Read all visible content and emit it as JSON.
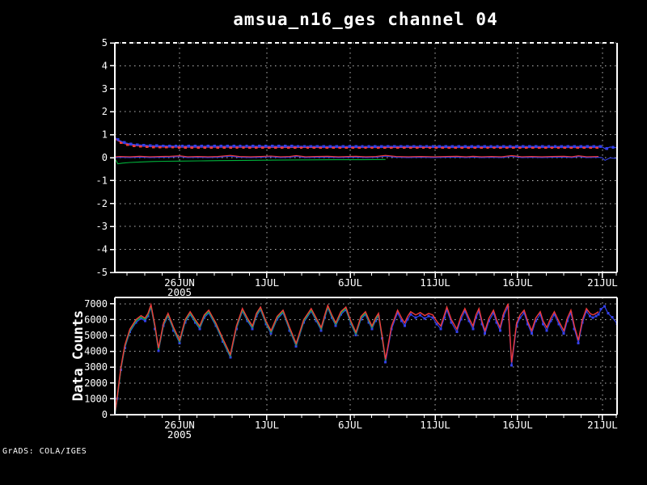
{
  "title": "amsua_n16_ges channel 04",
  "page": {
    "credit": "GrADS: COLA/IGES",
    "background": "#000000"
  },
  "colors": {
    "red": "#f03a3a",
    "green": "#00b43c",
    "blue": "#3340e8",
    "axis": "#ffffff",
    "grid": "#b8b8b8",
    "text": "#ffffff"
  },
  "x_axis": {
    "labels": [
      "26JUN",
      "1JUL",
      "6JUL",
      "11JUL",
      "16JUL",
      "21JUL"
    ],
    "year_label": "2005",
    "year_under_index": 0,
    "label_positions": [
      0.1288,
      0.3027,
      0.4686,
      0.6377,
      0.8019,
      0.971
    ],
    "minor_tick_step": 0.03478
  },
  "chart_data": [
    {
      "type": "line",
      "title": "amsua_n16_ges channel 04",
      "ylim": [
        -5,
        5
      ],
      "yticks": [
        5,
        4,
        3,
        2,
        1,
        0,
        -1,
        -2,
        -3,
        -4,
        -5
      ],
      "grid": "dotted",
      "series": [
        {
          "name": "top-green-line",
          "color": "green",
          "style": "line",
          "points": [
            [
              0.0,
              -0.04
            ],
            [
              0.006,
              -0.27
            ],
            [
              0.015,
              -0.24
            ],
            [
              0.03,
              -0.21
            ],
            [
              0.05,
              -0.19
            ],
            [
              0.075,
              -0.17
            ],
            [
              0.1,
              -0.16
            ],
            [
              0.13,
              -0.15
            ],
            [
              0.17,
              -0.14
            ],
            [
              0.21,
              -0.13
            ],
            [
              0.26,
              -0.12
            ],
            [
              0.32,
              -0.11
            ],
            [
              0.38,
              -0.1
            ],
            [
              0.44,
              -0.09
            ],
            [
              0.49,
              -0.09
            ],
            [
              0.539,
              -0.08
            ]
          ]
        },
        {
          "name": "top-blue-line",
          "color": "blue",
          "style": "line",
          "from": "top-red-line",
          "value_offset": -0.035,
          "extra": [
            [
              0.97,
              0.0
            ],
            [
              0.976,
              -0.12
            ],
            [
              0.986,
              -0.01
            ],
            [
              1.0,
              -0.04
            ]
          ]
        },
        {
          "name": "top-red-line",
          "color": "red",
          "style": "line",
          "points": [
            [
              0.0,
              0.03
            ],
            [
              0.01,
              0.05
            ],
            [
              0.03,
              0.04
            ],
            [
              0.05,
              0.06
            ],
            [
              0.07,
              0.04
            ],
            [
              0.09,
              0.05
            ],
            [
              0.11,
              0.06
            ],
            [
              0.129,
              0.08
            ],
            [
              0.145,
              0.04
            ],
            [
              0.165,
              0.05
            ],
            [
              0.185,
              0.04
            ],
            [
              0.205,
              0.05
            ],
            [
              0.23,
              0.1
            ],
            [
              0.248,
              0.05
            ],
            [
              0.27,
              0.04
            ],
            [
              0.29,
              0.05
            ],
            [
              0.311,
              0.07
            ],
            [
              0.33,
              0.04
            ],
            [
              0.348,
              0.05
            ],
            [
              0.361,
              0.09
            ],
            [
              0.38,
              0.04
            ],
            [
              0.4,
              0.05
            ],
            [
              0.424,
              0.06
            ],
            [
              0.445,
              0.04
            ],
            [
              0.465,
              0.05
            ],
            [
              0.48,
              0.06
            ],
            [
              0.5,
              0.04
            ],
            [
              0.52,
              0.05
            ],
            [
              0.539,
              0.1
            ],
            [
              0.56,
              0.05
            ],
            [
              0.585,
              0.04
            ],
            [
              0.61,
              0.05
            ],
            [
              0.635,
              0.04
            ],
            [
              0.66,
              0.05
            ],
            [
              0.681,
              0.06
            ],
            [
              0.7,
              0.04
            ],
            [
              0.713,
              0.06
            ],
            [
              0.73,
              0.04
            ],
            [
              0.75,
              0.05
            ],
            [
              0.77,
              0.04
            ],
            [
              0.79,
              0.09
            ],
            [
              0.81,
              0.04
            ],
            [
              0.83,
              0.05
            ],
            [
              0.85,
              0.04
            ],
            [
              0.87,
              0.05
            ],
            [
              0.894,
              0.06
            ],
            [
              0.91,
              0.04
            ],
            [
              0.923,
              0.08
            ],
            [
              0.94,
              0.04
            ],
            [
              0.963,
              0.05
            ]
          ]
        },
        {
          "name": "top-red-band",
          "color": "red",
          "style": "band",
          "marker_step": 0.0128,
          "marker_phase": 0,
          "points": [
            [
              0.0,
              0.82
            ],
            [
              0.004,
              0.76
            ],
            [
              0.009,
              0.7
            ],
            [
              0.015,
              0.64
            ],
            [
              0.022,
              0.59
            ],
            [
              0.03,
              0.55
            ],
            [
              0.04,
              0.52
            ],
            [
              0.052,
              0.5
            ],
            [
              0.065,
              0.48
            ],
            [
              0.08,
              0.47
            ],
            [
              0.1,
              0.46
            ],
            [
              0.13,
              0.455
            ],
            [
              0.17,
              0.45
            ],
            [
              0.22,
              0.45
            ],
            [
              0.28,
              0.448
            ],
            [
              0.35,
              0.445
            ],
            [
              0.42,
              0.44
            ],
            [
              0.5,
              0.44
            ],
            [
              0.58,
              0.443
            ],
            [
              0.66,
              0.44
            ],
            [
              0.74,
              0.44
            ],
            [
              0.82,
              0.44
            ],
            [
              0.9,
              0.44
            ],
            [
              0.963,
              0.44
            ]
          ]
        },
        {
          "name": "top-blue-band",
          "color": "blue",
          "style": "band",
          "marker_step": 0.0128,
          "marker_phase": 0.5,
          "from": "top-red-band",
          "value_offset": 0.05,
          "extra": [
            [
              0.97,
              0.47
            ],
            [
              0.977,
              0.38
            ],
            [
              0.986,
              0.46
            ],
            [
              1.0,
              0.43
            ]
          ]
        }
      ]
    },
    {
      "type": "line",
      "ylabel": "Data Counts",
      "ylim": [
        0,
        7400
      ],
      "yticks": [
        7000,
        6000,
        5000,
        4000,
        3000,
        2000,
        1000,
        0
      ],
      "grid": "dotted",
      "series": [
        {
          "name": "bottom-blue",
          "color": "blue",
          "style": "line-markers",
          "from": "bottom-red",
          "value_offset": -180,
          "extra": [
            [
              0.968,
              6650
            ],
            [
              0.975,
              6850
            ],
            [
              0.982,
              6400
            ],
            [
              0.99,
              6150
            ],
            [
              1.0,
              5750
            ]
          ]
        },
        {
          "name": "bottom-green",
          "color": "green",
          "style": "line",
          "from": "bottom-red",
          "value_offset": -90,
          "u_max": 0.539
        },
        {
          "name": "bottom-red",
          "color": "red",
          "style": "line",
          "points": [
            [
              0.0,
              50
            ],
            [
              0.005,
              1200
            ],
            [
              0.012,
              3000
            ],
            [
              0.02,
              4400
            ],
            [
              0.03,
              5400
            ],
            [
              0.042,
              6000
            ],
            [
              0.052,
              6250
            ],
            [
              0.06,
              6100
            ],
            [
              0.066,
              6400
            ],
            [
              0.072,
              6950
            ],
            [
              0.08,
              5600
            ],
            [
              0.087,
              4200
            ],
            [
              0.097,
              5800
            ],
            [
              0.106,
              6400
            ],
            [
              0.117,
              5500
            ],
            [
              0.129,
              4700
            ],
            [
              0.14,
              6000
            ],
            [
              0.15,
              6500
            ],
            [
              0.16,
              6000
            ],
            [
              0.169,
              5600
            ],
            [
              0.178,
              6300
            ],
            [
              0.187,
              6600
            ],
            [
              0.201,
              5800
            ],
            [
              0.215,
              4800
            ],
            [
              0.23,
              3800
            ],
            [
              0.242,
              5600
            ],
            [
              0.254,
              6700
            ],
            [
              0.264,
              6100
            ],
            [
              0.274,
              5600
            ],
            [
              0.282,
              6400
            ],
            [
              0.29,
              6800
            ],
            [
              0.301,
              5900
            ],
            [
              0.311,
              5300
            ],
            [
              0.323,
              6200
            ],
            [
              0.335,
              6600
            ],
            [
              0.348,
              5500
            ],
            [
              0.361,
              4500
            ],
            [
              0.376,
              6000
            ],
            [
              0.391,
              6700
            ],
            [
              0.401,
              6100
            ],
            [
              0.411,
              5500
            ],
            [
              0.418,
              6300
            ],
            [
              0.424,
              6900
            ],
            [
              0.432,
              6300
            ],
            [
              0.44,
              5800
            ],
            [
              0.45,
              6500
            ],
            [
              0.46,
              6800
            ],
            [
              0.47,
              5900
            ],
            [
              0.48,
              5200
            ],
            [
              0.49,
              6200
            ],
            [
              0.499,
              6500
            ],
            [
              0.506,
              6000
            ],
            [
              0.512,
              5600
            ],
            [
              0.519,
              6100
            ],
            [
              0.525,
              6400
            ],
            [
              0.532,
              5000
            ],
            [
              0.539,
              3500
            ],
            [
              0.551,
              5600
            ],
            [
              0.563,
              6600
            ],
            [
              0.571,
              6100
            ],
            [
              0.577,
              5800
            ],
            [
              0.583,
              6200
            ],
            [
              0.589,
              6500
            ],
            [
              0.599,
              6300
            ],
            [
              0.608,
              6450
            ],
            [
              0.617,
              6250
            ],
            [
              0.625,
              6400
            ],
            [
              0.633,
              6300
            ],
            [
              0.641,
              5900
            ],
            [
              0.649,
              5600
            ],
            [
              0.656,
              6300
            ],
            [
              0.661,
              6800
            ],
            [
              0.67,
              6000
            ],
            [
              0.681,
              5400
            ],
            [
              0.689,
              6200
            ],
            [
              0.697,
              6700
            ],
            [
              0.705,
              6100
            ],
            [
              0.713,
              5600
            ],
            [
              0.719,
              6300
            ],
            [
              0.725,
              6700
            ],
            [
              0.731,
              5900
            ],
            [
              0.737,
              5300
            ],
            [
              0.745,
              6100
            ],
            [
              0.754,
              6600
            ],
            [
              0.76,
              6000
            ],
            [
              0.767,
              5500
            ],
            [
              0.774,
              6400
            ],
            [
              0.783,
              7000
            ],
            [
              0.79,
              3300
            ],
            [
              0.8,
              5800
            ],
            [
              0.807,
              6300
            ],
            [
              0.815,
              6600
            ],
            [
              0.822,
              5900
            ],
            [
              0.83,
              5300
            ],
            [
              0.838,
              6100
            ],
            [
              0.847,
              6500
            ],
            [
              0.853,
              5900
            ],
            [
              0.86,
              5500
            ],
            [
              0.868,
              6100
            ],
            [
              0.875,
              6500
            ],
            [
              0.884,
              5900
            ],
            [
              0.894,
              5300
            ],
            [
              0.901,
              6100
            ],
            [
              0.908,
              6600
            ],
            [
              0.915,
              5600
            ],
            [
              0.923,
              4700
            ],
            [
              0.931,
              6000
            ],
            [
              0.939,
              6700
            ],
            [
              0.946,
              6400
            ],
            [
              0.952,
              6300
            ],
            [
              0.958,
              6400
            ],
            [
              0.963,
              6500
            ]
          ]
        }
      ]
    }
  ]
}
